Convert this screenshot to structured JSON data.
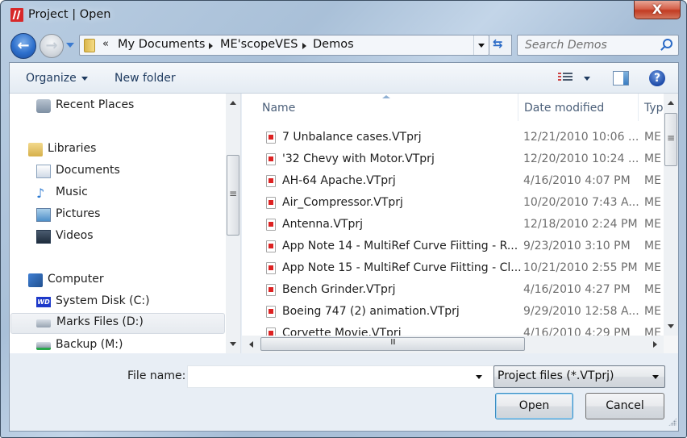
{
  "window": {
    "title": "Project | Open",
    "close_label": "X"
  },
  "navigation": {
    "back_label": "Back",
    "forward_label": "Forward",
    "breadcrumb_overflow": "«",
    "breadcrumbs": [
      "My Documents",
      "ME'scopeVES",
      "Demos"
    ],
    "search_placeholder": "Search Demos"
  },
  "toolbar": {
    "organize_label": "Organize",
    "new_folder_label": "New folder",
    "help_glyph": "?"
  },
  "nav_pane": {
    "items": [
      {
        "label": "Recent Places",
        "icon": "recent-places-icon"
      },
      {
        "label": "Libraries",
        "icon": "libraries-icon"
      },
      {
        "label": "Documents",
        "icon": "documents-icon"
      },
      {
        "label": "Music",
        "icon": "music-icon"
      },
      {
        "label": "Pictures",
        "icon": "pictures-icon"
      },
      {
        "label": "Videos",
        "icon": "videos-icon"
      },
      {
        "label": "Computer",
        "icon": "computer-icon"
      },
      {
        "label": "System Disk (C:)",
        "icon": "wd-drive-icon"
      },
      {
        "label": "Marks Files (D:)",
        "icon": "network-drive-icon",
        "selected": true
      },
      {
        "label": "Backup (M:)",
        "icon": "backup-drive-icon"
      }
    ]
  },
  "file_list": {
    "columns": [
      "Name",
      "Date modified",
      "Typ"
    ],
    "rows": [
      {
        "name": "7 Unbalance cases.VTprj",
        "date": "12/21/2010 10:06 ...",
        "type": "ME'"
      },
      {
        "name": "'32 Chevy with Motor.VTprj",
        "date": "12/20/2010 10:24 ...",
        "type": "ME'"
      },
      {
        "name": "AH-64 Apache.VTprj",
        "date": "4/16/2010 4:07 PM",
        "type": "ME'"
      },
      {
        "name": "Air_Compressor.VTprj",
        "date": "10/20/2010 7:43 A...",
        "type": "ME'"
      },
      {
        "name": "Antenna.VTprj",
        "date": "12/18/2010 2:24 PM",
        "type": "ME'"
      },
      {
        "name": "App Note 14 - MultiRef Curve Fiitting - R...",
        "date": "9/23/2010 3:10 PM",
        "type": "ME'"
      },
      {
        "name": "App Note 15 - MultiRef Curve Fiitting - Cl...",
        "date": "10/21/2010 2:55 PM",
        "type": "ME'"
      },
      {
        "name": "Bench Grinder.VTprj",
        "date": "4/16/2010 4:27 PM",
        "type": "ME'"
      },
      {
        "name": "Boeing 747 (2) animation.VTprj",
        "date": "9/29/2010 12:58 A...",
        "type": "ME'"
      },
      {
        "name": "Corvette Movie.VTprj",
        "date": "4/16/2010 4:29 PM",
        "type": "ME'"
      }
    ]
  },
  "footer": {
    "file_name_label": "File name:",
    "file_name_value": "",
    "file_type_selected": "Project files (*.VTprj)",
    "open_label": "Open",
    "cancel_label": "Cancel"
  }
}
